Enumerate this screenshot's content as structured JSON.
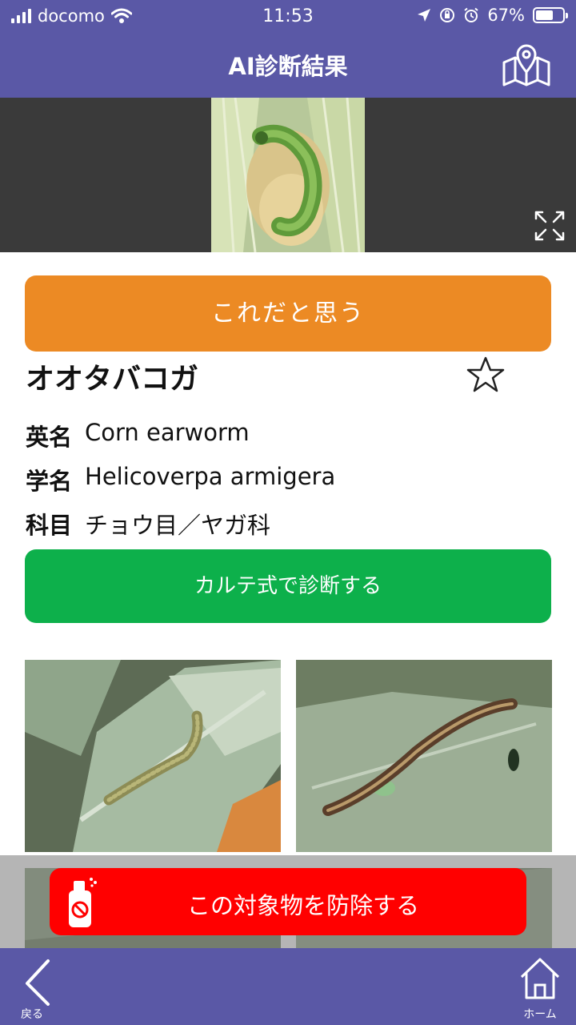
{
  "status_bar": {
    "carrier": "docomo",
    "time": "11:53",
    "battery": "67%",
    "battery_level": 0.67
  },
  "header": {
    "title": "AI診断結果",
    "map_icon": "map-pin-icon"
  },
  "result": {
    "confirm_button": "これだと思う",
    "name": "オオタバコガ",
    "english_label": "英名",
    "english_value": "Corn earworm",
    "scientific_label": "学名",
    "scientific_value": "Helicoverpa armigera",
    "family_label": "科目",
    "family_value": "チョウ目／ヤガ科",
    "karte_button": "カルテ式で診断する"
  },
  "control_button": "この対象物を防除する",
  "bottom_nav": {
    "back_label": "戻る",
    "home_label": "ホーム"
  },
  "colors": {
    "brand": "#5a58a6",
    "confirm": "#ec8a24",
    "karte": "#0db04b",
    "control": "#ff0000"
  }
}
